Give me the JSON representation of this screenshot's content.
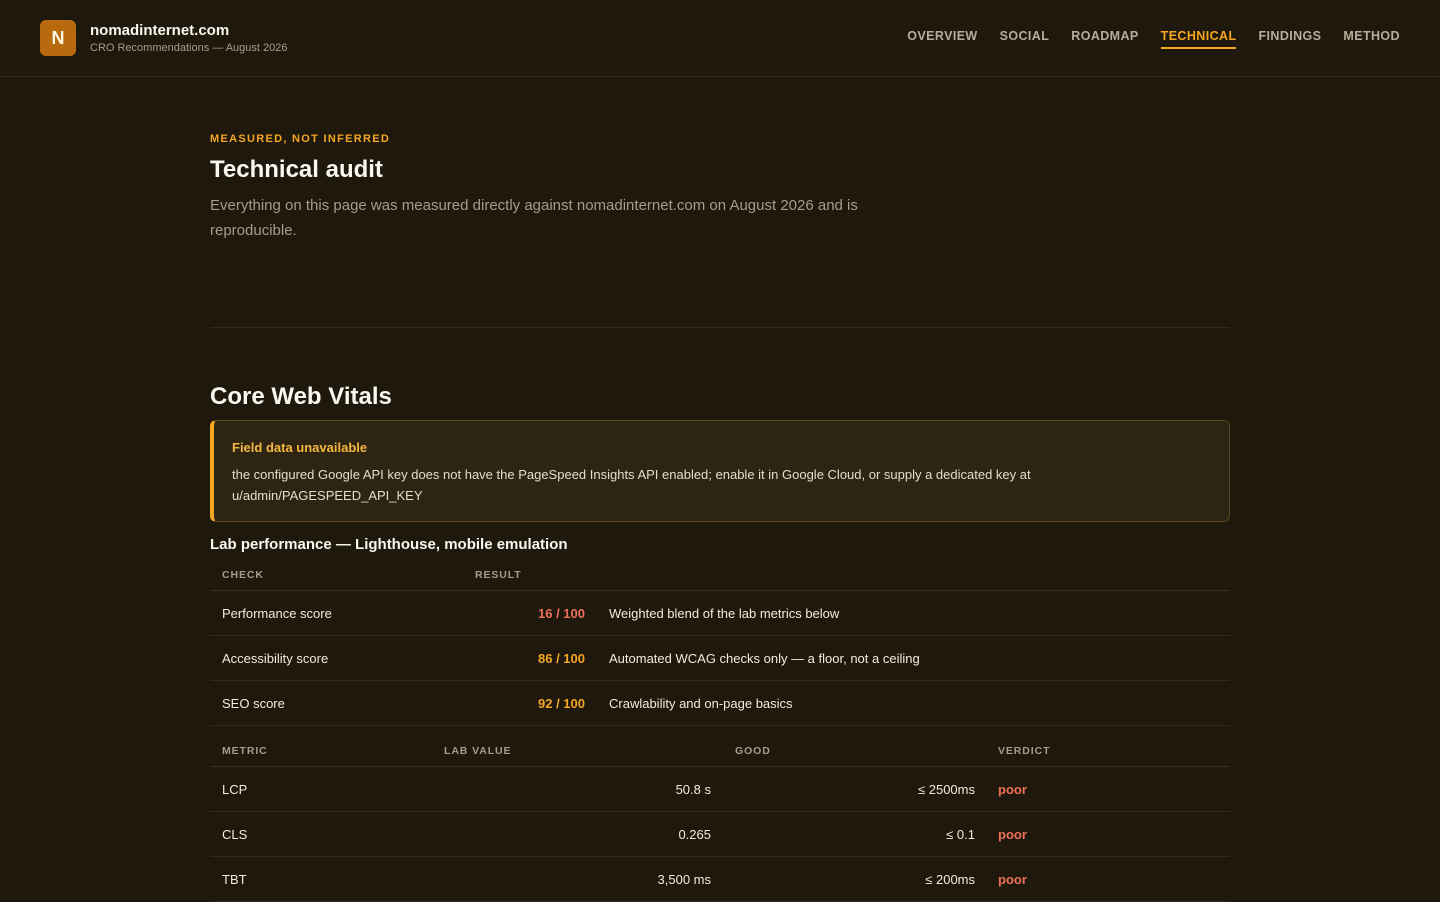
{
  "brand": {
    "logo_letter": "N",
    "name": "nomadinternet.com",
    "subtitle": "CRO Recommendations — August 2026"
  },
  "nav": {
    "items": [
      "OVERVIEW",
      "SOCIAL",
      "ROADMAP",
      "TECHNICAL",
      "FINDINGS",
      "METHOD"
    ],
    "active": "TECHNICAL"
  },
  "hero": {
    "eyebrow": "MEASURED, NOT INFERRED",
    "title": "Technical audit",
    "description": "Everything on this page was measured directly against nomadinternet.com on August 2026 and is reproducible."
  },
  "cwv": {
    "title": "Core Web Vitals",
    "alert": {
      "title": "Field data unavailable",
      "body": "the configured Google API key does not have the PageSpeed Insights API enabled; enable it in Google Cloud, or supply a dedicated key at u/admin/PAGESPEED_API_KEY"
    },
    "lab_title": "Lab performance — Lighthouse, mobile emulation",
    "scores_table": {
      "headers": {
        "check": "CHECK",
        "result": "RESULT"
      },
      "rows": [
        {
          "check": "Performance score",
          "result": "16 / 100",
          "note": "Weighted blend of the lab metrics below"
        },
        {
          "check": "Accessibility score",
          "result": "86 / 100",
          "note": "Automated WCAG checks only — a floor, not a ceiling"
        },
        {
          "check": "SEO score",
          "result": "92 / 100",
          "note": "Crawlability and on-page basics"
        }
      ]
    },
    "metrics_table": {
      "headers": {
        "metric": "METRIC",
        "lab_value": "LAB VALUE",
        "good": "GOOD",
        "verdict": "VERDICT"
      },
      "rows": [
        {
          "metric": "LCP",
          "lab_value": "50.8 s",
          "good": "≤ 2500ms",
          "verdict": "poor"
        },
        {
          "metric": "CLS",
          "lab_value": "0.265",
          "good": "≤ 0.1",
          "verdict": "poor"
        },
        {
          "metric": "TBT",
          "lab_value": "3,500 ms",
          "good": "≤ 200ms",
          "verdict": "poor"
        }
      ]
    }
  },
  "colors": {
    "accent": "#f5a623",
    "poor": "#ec7158",
    "background": "#1f180d"
  }
}
